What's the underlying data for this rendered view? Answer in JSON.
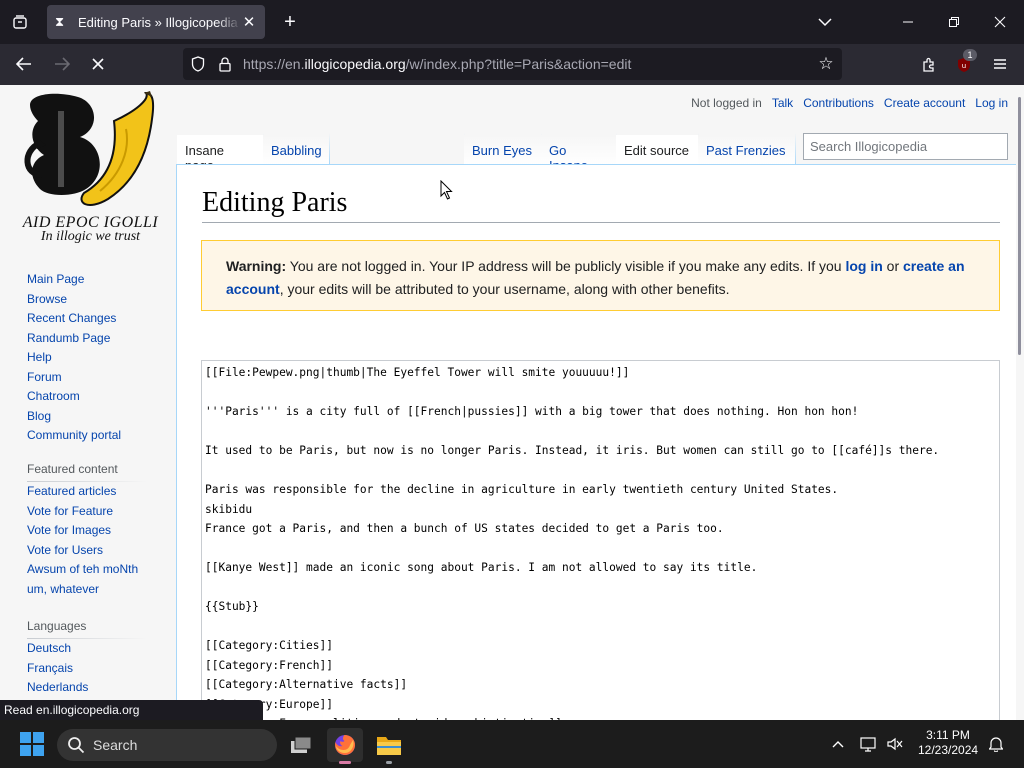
{
  "browser": {
    "tab_title": "Editing Paris » Illogicopedia - T",
    "url_prefix": "https://en.",
    "url_host": "illogicopedia.org",
    "url_path": "/w/index.php?title=Paris&action=edit",
    "extension_badge": "1"
  },
  "site": {
    "logo_line1": "AID EPOC IGOLLI",
    "logo_line2": "In illogic we trust"
  },
  "personal": {
    "not_logged_in": "Not logged in",
    "talk": "Talk",
    "contributions": "Contributions",
    "create_account": "Create account",
    "log_in": "Log in"
  },
  "tabs": {
    "insane_page": "Insane page",
    "babbling": "Babbling",
    "burn_eyes": "Burn Eyes",
    "go_insane": "Go Insane",
    "edit_source": "Edit source",
    "past_frenzies": "Past Frenzies"
  },
  "search": {
    "placeholder": "Search Illogicopedia"
  },
  "sidebar": {
    "nav": [
      "Main Page",
      "Browse",
      "Recent Changes",
      "Randumb Page",
      "Help",
      "Forum",
      "Chatroom",
      "Blog",
      "Community portal"
    ],
    "featured_heading": "Featured content",
    "featured": [
      "Featured articles",
      "Vote for Feature",
      "Vote for Images",
      "Vote for Users",
      "Awsum of teh moNth",
      "um, whatever"
    ],
    "languages_heading": "Languages",
    "languages": [
      "Deutsch",
      "Français",
      "Nederlands"
    ]
  },
  "heading": "Editing Paris",
  "warning": {
    "label": "Warning:",
    "text1": " You are not logged in. Your IP address will be publicly visible if you make any edits. If you ",
    "log_in": "log in",
    "text2": " or ",
    "create": "create an account",
    "text3": ", your edits will be attributed to your username, along with other benefits."
  },
  "editor_lines": [
    "[[File:Pewpew.png|thumb|The Eyeffel Tower will smite youuuuu!]]",
    "",
    "'''Paris''' is a city full of [[French|pussies]] with a big tower that does nothing. Hon hon hon!",
    "",
    "It used to be Paris, but now is no longer Paris. Instead, it iris. But women can still go to [[café]]s there.",
    "",
    "Paris was responsible for the decline in agriculture in early twentieth century United States.",
    "skibidu",
    "France got a Paris, and then a bunch of US states decided to get a Paris too.",
    "",
    "[[Kanye West]] made an iconic song about Paris. I am not allowed to say its title.",
    "",
    "{{Stub}}",
    "",
    "[[Category:Cities]]",
    "[[Category:French]]",
    "[[Category:Alternative facts]]",
    "[[Category:Europe]]",
    "[[Category:Fancy politics and stupid sophistication]]"
  ],
  "status_bar": "Read en.illogicopedia.org",
  "taskbar": {
    "search_label": "Search",
    "time": "3:11 PM",
    "date": "12/23/2024"
  }
}
